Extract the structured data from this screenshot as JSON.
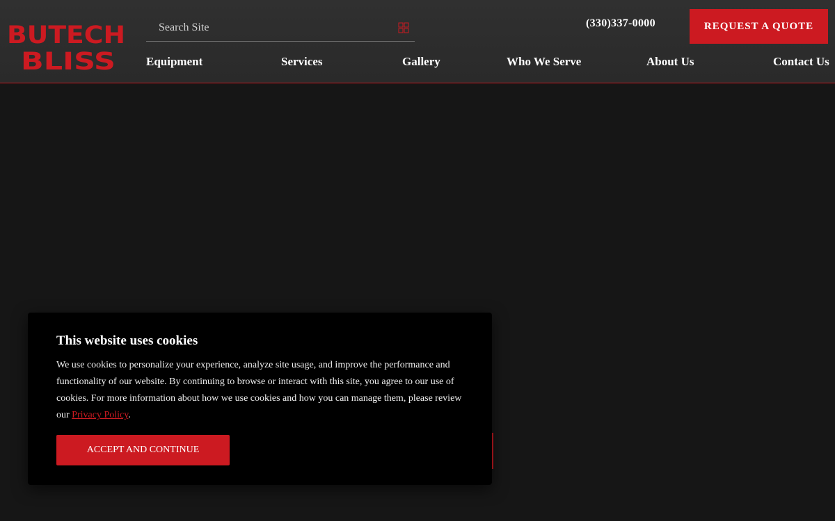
{
  "brand": {
    "logo_line1": "BUTECH",
    "logo_line2": "BLISS",
    "accent_color": "#cc1a21"
  },
  "header": {
    "search_placeholder": "Search Site",
    "search_icon": "search-icon",
    "phone": "(330)337-0000",
    "quote_label": "REQUEST A QUOTE"
  },
  "nav": {
    "items": [
      {
        "label": "Equipment"
      },
      {
        "label": "Services"
      },
      {
        "label": "Gallery"
      },
      {
        "label": "Who We Serve"
      },
      {
        "label": "About Us"
      },
      {
        "label": "Contact Us"
      }
    ]
  },
  "cookie": {
    "title": "This website uses cookies",
    "body": "We use cookies to personalize your experience, analyze site usage, and improve the performance and functionality of our website. By continuing to browse or interact with this site, you agree to our use of cookies. For more information about how we use cookies and how you can manage them, please review our ",
    "link_text": "Privacy Policy",
    "after_link": ".",
    "accept_label": "ACCEPT AND CONTINUE"
  }
}
